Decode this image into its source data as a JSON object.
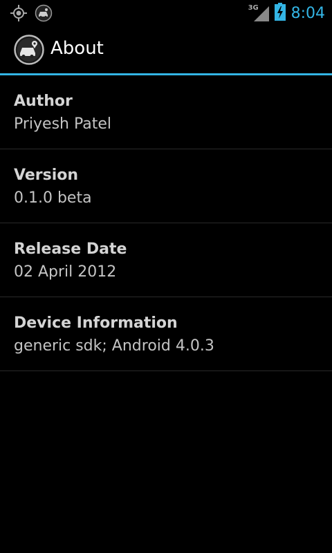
{
  "status_bar": {
    "network": "3G",
    "time": "8:04",
    "left_icons": [
      "gps-icon",
      "car-app-notification-icon"
    ],
    "right_icons": [
      "signal-icon",
      "battery-charging-icon"
    ]
  },
  "action_bar": {
    "title": "About",
    "icon": "car-app-icon"
  },
  "items": [
    {
      "label": "Author",
      "value": "Priyesh Patel"
    },
    {
      "label": "Version",
      "value": "0.1.0 beta"
    },
    {
      "label": "Release Date",
      "value": "02 April 2012"
    },
    {
      "label": "Device Information",
      "value": "generic sdk; Android 4.0.3"
    }
  ],
  "colors": {
    "accent": "#33b5e5",
    "background": "#000000",
    "divider": "#2a2a2a"
  }
}
